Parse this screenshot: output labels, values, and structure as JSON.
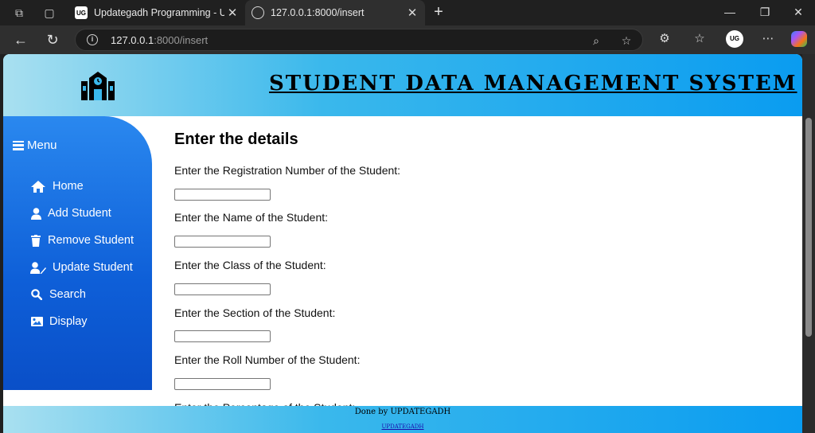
{
  "browser": {
    "tabs": [
      {
        "title": "Updategadh Programming - Upd",
        "favicon": "UG"
      },
      {
        "title": "127.0.0.1:8000/insert",
        "favicon": "globe-icon"
      }
    ],
    "url_host": "127.0.0.1",
    "url_rest": ":8000/insert",
    "profile_initials": "UG"
  },
  "header": {
    "title": "STUDENT DATA MANAGEMENT SYSTEM",
    "logo_icon": "school-building-icon"
  },
  "sidebar": {
    "menu_label": "Menu",
    "items": [
      {
        "label": "Home",
        "icon": "home-icon"
      },
      {
        "label": "Add Student",
        "icon": "user-icon"
      },
      {
        "label": "Remove Student",
        "icon": "trash-icon"
      },
      {
        "label": "Update Student",
        "icon": "user-edit-icon"
      },
      {
        "label": "Search",
        "icon": "search-icon"
      },
      {
        "label": "Display",
        "icon": "image-icon"
      }
    ]
  },
  "form": {
    "title": "Enter the details",
    "fields": [
      {
        "label": "Enter the Registration Number of the Student:",
        "value": ""
      },
      {
        "label": "Enter the Name of the Student:",
        "value": ""
      },
      {
        "label": "Enter the Class of the Student:",
        "value": ""
      },
      {
        "label": "Enter the Section of the Student:",
        "value": ""
      },
      {
        "label": "Enter the Roll Number of the Student:",
        "value": ""
      },
      {
        "label": "Enter the Percentage of the Student:",
        "value": ""
      }
    ]
  },
  "footer": {
    "text": "Done by UPDATEGADH",
    "link": "UPDATEGADH"
  },
  "colors": {
    "sidebar": "#1a6fe0",
    "header_start": "#a9e0f0",
    "header_end": "#0a9cf0"
  }
}
